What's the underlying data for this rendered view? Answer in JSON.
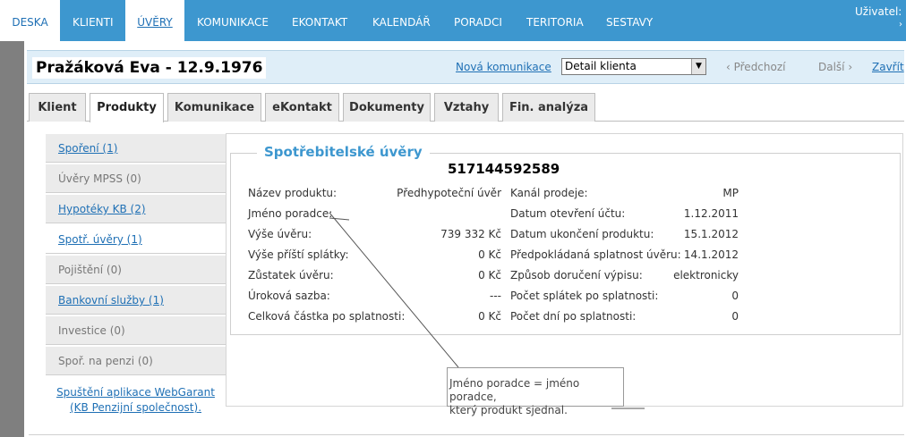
{
  "nav": {
    "items": [
      "DESKA",
      "KLIENTI",
      "ÚVĚRY",
      "KOMUNIKACE",
      "EKONTAKT",
      "KALENDÁŘ",
      "PORADCI",
      "TERITORIA",
      "SESTAVY"
    ],
    "user_label": "Uživatel:"
  },
  "header": {
    "title": "Pražáková Eva - 12.9.1976",
    "new_communication": "Nová komunikace",
    "select_value": "Detail klienta",
    "prev": "‹ Předchozí",
    "next": "Další ›",
    "close": "Zavřít"
  },
  "tabs": [
    "Klient",
    "Produkty",
    "Komunikace",
    "eKontakt",
    "Dokumenty",
    "Vztahy",
    "Fin. analýza"
  ],
  "products_menu": [
    "Spoření (1)",
    "Úvěry MPSS (0)",
    "Hypotéky KB (2)",
    "Spotř. úvěry (1)",
    "Pojištění (0)",
    "Bankovní služby (1)",
    "Investice (0)",
    "Spoř. na penzi (0)"
  ],
  "webgarant_link": [
    "Spuštění aplikace WebGarant",
    "(KB Penzijní společnost)."
  ],
  "panel": {
    "legend": "Spotřebitelské úvěry",
    "account_number": "517144592589",
    "left": [
      {
        "label": "Název produktu:",
        "value": "Předhypoteční úvěr"
      },
      {
        "label": "Jméno poradce:",
        "value": ""
      },
      {
        "label": "Výše úvěru:",
        "value": "739 332 Kč"
      },
      {
        "label": "Výše příští splátky:",
        "value": "0 Kč"
      },
      {
        "label": "Zůstatek úvěru:",
        "value": "0 Kč"
      },
      {
        "label": "Úroková sazba:",
        "value": "---"
      },
      {
        "label": "Celková částka po splatnosti:",
        "value": "0 Kč"
      }
    ],
    "right": [
      {
        "label": "Kanál prodeje:",
        "value": "MP"
      },
      {
        "label": "Datum otevření účtu:",
        "value": "1.12.2011"
      },
      {
        "label": "Datum ukončení produktu:",
        "value": "15.1.2012"
      },
      {
        "label": "Předpokládaná splatnost úvěru:",
        "value": "14.1.2012"
      },
      {
        "label": "Způsob doručení výpisu:",
        "value": "elektronicky"
      },
      {
        "label": "Počet splátek po splatnosti:",
        "value": "0"
      },
      {
        "label": "Počet dní po splatnosti:",
        "value": "0"
      }
    ]
  },
  "annotation": {
    "line1": "Jméno poradce = jméno poradce,",
    "line2": "který produkt sjednal."
  },
  "colors": {
    "nav_bg": "#3d97cf",
    "link": "#1f70b5",
    "legend": "#3d97cf"
  }
}
